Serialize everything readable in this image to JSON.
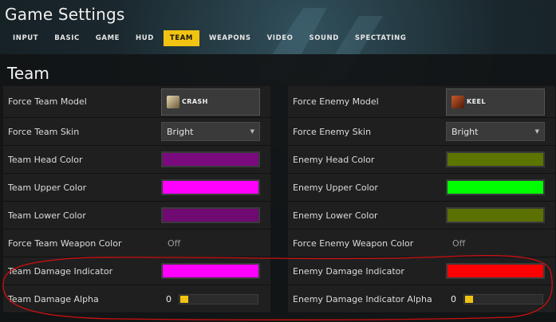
{
  "window": {
    "title": "Game Settings"
  },
  "tabs": [
    {
      "label": "INPUT",
      "active": false
    },
    {
      "label": "BASIC",
      "active": false
    },
    {
      "label": "GAME",
      "active": false
    },
    {
      "label": "HUD",
      "active": false
    },
    {
      "label": "TEAM",
      "active": true
    },
    {
      "label": "WEAPONS",
      "active": false
    },
    {
      "label": "VIDEO",
      "active": false
    },
    {
      "label": "SOUND",
      "active": false
    },
    {
      "label": "SPECTATING",
      "active": false
    }
  ],
  "section": {
    "title": "Team"
  },
  "team": {
    "model_label": "Force Team Model",
    "model_value": "CRASH",
    "skin_label": "Force Team Skin",
    "skin_value": "Bright",
    "head_label": "Team Head Color",
    "head_color": "#7a0a7e",
    "upper_label": "Team Upper Color",
    "upper_color": "#ff00ff",
    "lower_label": "Team Lower Color",
    "lower_color": "#6e0a72",
    "weapon_label": "Force Team Weapon Color",
    "weapon_value": "Off",
    "damage_label": "Team Damage Indicator",
    "damage_color": "#ff00ff",
    "alpha_label": "Team Damage Alpha",
    "alpha_value": "0",
    "alpha_fraction": 0
  },
  "enemy": {
    "model_label": "Force Enemy Model",
    "model_value": "KEEL",
    "skin_label": "Force Enemy Skin",
    "skin_value": "Bright",
    "head_label": "Enemy Head Color",
    "head_color": "#5c7400",
    "upper_label": "Enemy Upper Color",
    "upper_color": "#00ff00",
    "lower_label": "Enemy Lower Color",
    "lower_color": "#5a7000",
    "weapon_label": "Force Enemy Weapon Color",
    "weapon_value": "Off",
    "damage_label": "Enemy Damage Indicator",
    "damage_color": "#ff0000",
    "alpha_label": "Enemy Damage Indicator Alpha",
    "alpha_value": "0",
    "alpha_fraction": 0
  },
  "colors": {
    "accent": "#f2c411",
    "annotation": "#d01010"
  },
  "icons": {
    "select_chevron": "chevron-down-icon"
  }
}
